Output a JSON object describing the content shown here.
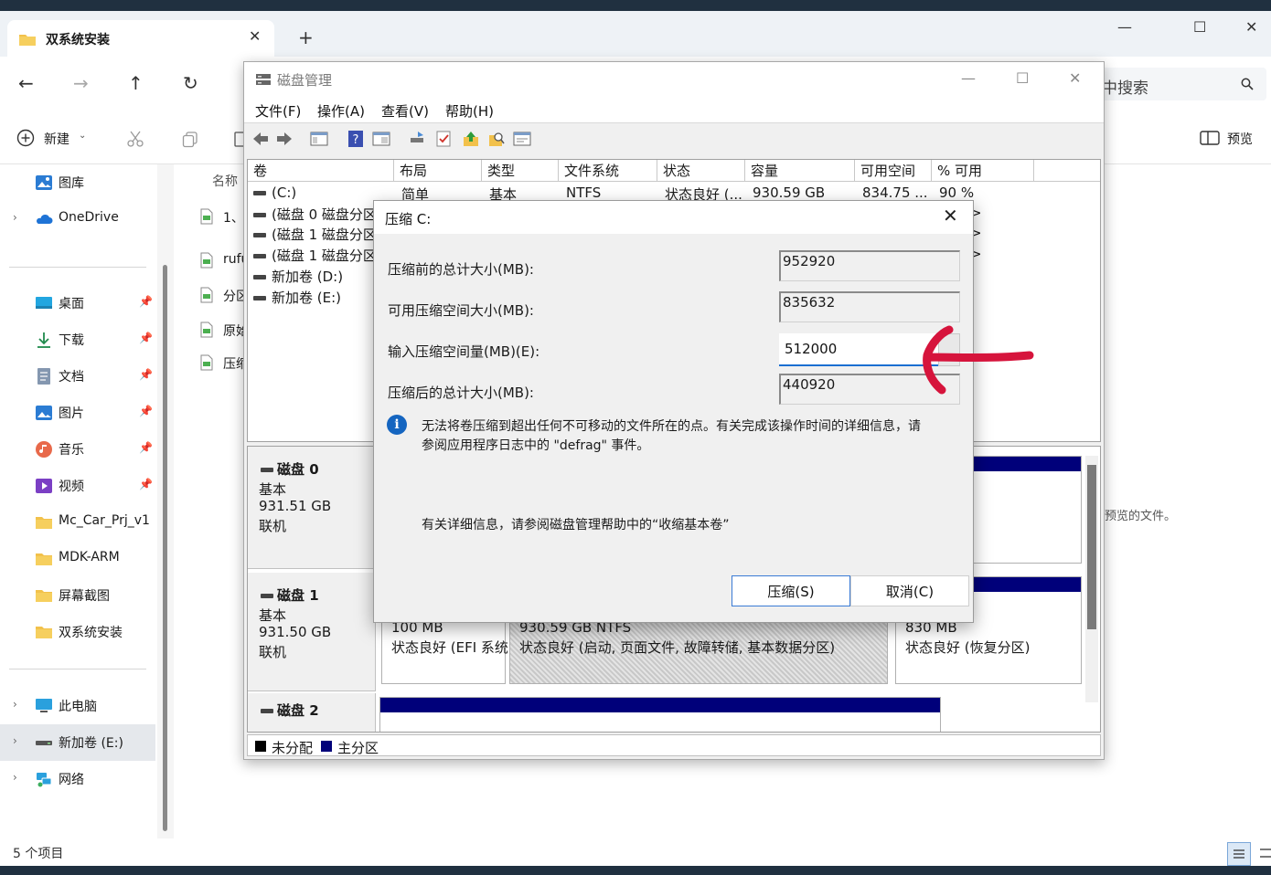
{
  "explorer": {
    "tab_title": "双系统安装",
    "search_text": "中搜索",
    "cmd": {
      "new_label": "新建",
      "preview_label": "预览"
    },
    "sidebar": {
      "top": [
        {
          "label": "图库",
          "icon": "gallery-icon",
          "chevron": false
        },
        {
          "label": "OneDrive",
          "icon": "onedrive-cloud-icon",
          "chevron": true
        }
      ],
      "quick": [
        {
          "label": "桌面",
          "icon": "desktop-icon",
          "pinned": true
        },
        {
          "label": "下载",
          "icon": "download-icon",
          "pinned": true
        },
        {
          "label": "文档",
          "icon": "document-icon",
          "pinned": true
        },
        {
          "label": "图片",
          "icon": "pictures-icon",
          "pinned": true
        },
        {
          "label": "音乐",
          "icon": "music-icon",
          "pinned": true
        },
        {
          "label": "视频",
          "icon": "video-icon",
          "pinned": true
        },
        {
          "label": "Mc_Car_Prj_v1",
          "icon": "folder-icon",
          "pinned": false
        },
        {
          "label": "MDK-ARM",
          "icon": "folder-icon",
          "pinned": false
        },
        {
          "label": "屏幕截图",
          "icon": "folder-icon",
          "pinned": false
        },
        {
          "label": "双系统安装",
          "icon": "folder-icon",
          "pinned": false
        }
      ],
      "bottom": [
        {
          "label": "此电脑",
          "icon": "this-pc-icon",
          "selected": false
        },
        {
          "label": "新加卷 (E:)",
          "icon": "drive-icon",
          "selected": true
        },
        {
          "label": "网络",
          "icon": "network-icon",
          "selected": false
        }
      ]
    },
    "content": {
      "column_name": "名称",
      "files": [
        "1、",
        "rufu",
        "分区",
        "原始",
        "压缩"
      ],
      "preview_message": "预览的文件。"
    },
    "status_count": "5 个项目"
  },
  "diskmgmt": {
    "title": "磁盘管理",
    "menu": [
      "文件(F)",
      "操作(A)",
      "查看(V)",
      "帮助(H)"
    ],
    "volume_columns": [
      "卷",
      "布局",
      "类型",
      "文件系统",
      "状态",
      "容量",
      "可用空间",
      "% 可用"
    ],
    "volumes": [
      {
        "name": "(C:)",
        "layout": "简单",
        "type": "基本",
        "fs": "NTFS",
        "status": "状态良好 (...",
        "capacity": "930.59 GB",
        "free": "834.75 ...",
        "pct": "90 %"
      },
      {
        "name": "(磁盘 0 磁盘分区"
      },
      {
        "name": "(磁盘 1 磁盘分区"
      },
      {
        "name": "(磁盘 1 磁盘分区"
      },
      {
        "name": "新加卷 (D:)"
      },
      {
        "name": "新加卷 (E:)"
      }
    ],
    "volume_right_fragments": [
      ">",
      ">",
      ">"
    ],
    "disks": [
      {
        "name": "磁盘 0",
        "type": "基本",
        "size": "931.51 GB",
        "status": "联机"
      },
      {
        "name": "磁盘 1",
        "type": "基本",
        "size": "931.50 GB",
        "status": "联机"
      },
      {
        "name": "磁盘 2"
      }
    ],
    "disk1_partitions": [
      {
        "size": "100 MB",
        "status": "状态良好 (EFI 系统"
      },
      {
        "size": "930.59 GB NTFS",
        "status": "状态良好 (启动, 页面文件, 故障转储, 基本数据分区)"
      },
      {
        "size": "830 MB",
        "status": "状态良好 (恢复分区)"
      }
    ],
    "legend": [
      {
        "label": "未分配",
        "color": "#000000"
      },
      {
        "label": "主分区",
        "color": "#00007a"
      }
    ]
  },
  "shrink_dialog": {
    "title": "压缩 C:",
    "rows": [
      {
        "label": "压缩前的总计大小(MB):",
        "value": "952920"
      },
      {
        "label": "可用压缩空间大小(MB):",
        "value": "835632"
      },
      {
        "label": "输入压缩空间量(MB)(E):",
        "value": "512000"
      },
      {
        "label": "压缩后的总计大小(MB):",
        "value": "440920"
      }
    ],
    "note_line1": "无法将卷压缩到超出任何不可移动的文件所在的点。有关完成该操作时间的详细信息，请",
    "note_line2": "参阅应用程序日志中的 \"defrag\" 事件。",
    "help_text": "有关详细信息，请参阅磁盘管理帮助中的“收缩基本卷”",
    "ok_label": "压缩(S)",
    "cancel_label": "取消(C)",
    "annotation_color": "#d6143c"
  }
}
